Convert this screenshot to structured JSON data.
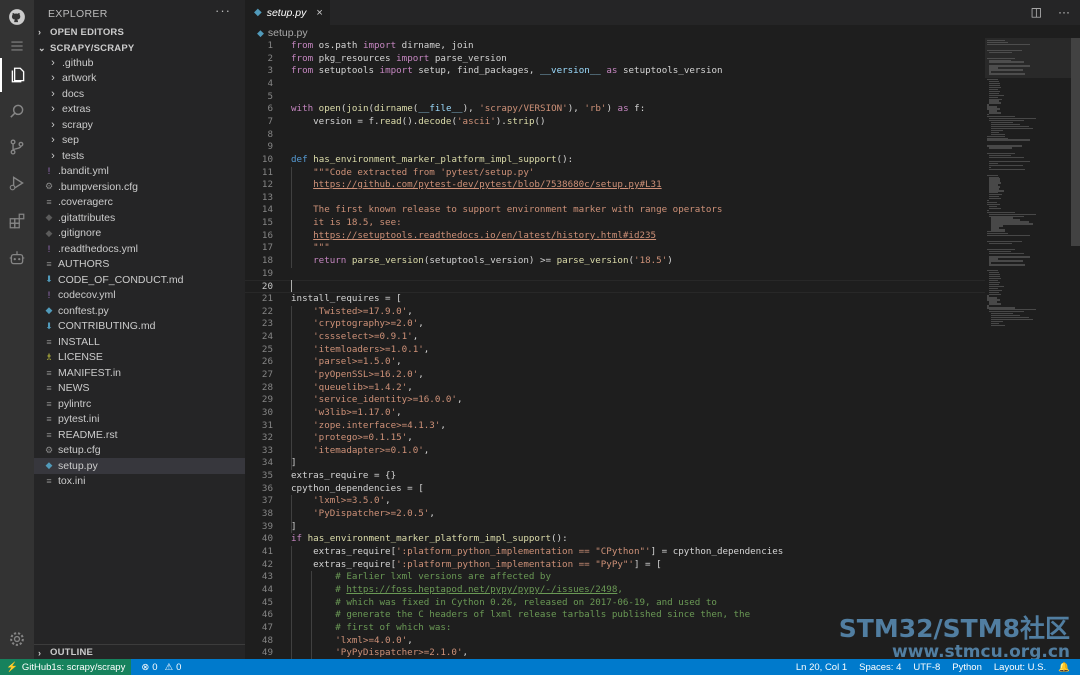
{
  "sidebar": {
    "title": "EXPLORER",
    "more": "···",
    "open_editors": "OPEN EDITORS",
    "folder_name": "SCRAPY/SCRAPY",
    "outline": "OUTLINE",
    "items": [
      {
        "type": "folder",
        "label": ".github"
      },
      {
        "type": "folder",
        "label": "artwork"
      },
      {
        "type": "folder",
        "label": "docs"
      },
      {
        "type": "folder",
        "label": "extras"
      },
      {
        "type": "folder",
        "label": "scrapy"
      },
      {
        "type": "folder",
        "label": "sep"
      },
      {
        "type": "folder",
        "label": "tests"
      },
      {
        "type": "file",
        "label": ".bandit.yml",
        "icon": "!",
        "color": "#a074c4"
      },
      {
        "type": "file",
        "label": ".bumpversion.cfg",
        "icon": "⚙",
        "color": "#8a8a8a"
      },
      {
        "type": "file",
        "label": ".coveragerc",
        "icon": "≡",
        "color": "#8a8a8a"
      },
      {
        "type": "file",
        "label": ".gitattributes",
        "icon": "◆",
        "color": "#5b5b5b"
      },
      {
        "type": "file",
        "label": ".gitignore",
        "icon": "◆",
        "color": "#5b5b5b"
      },
      {
        "type": "file",
        "label": ".readthedocs.yml",
        "icon": "!",
        "color": "#a074c4"
      },
      {
        "type": "file",
        "label": "AUTHORS",
        "icon": "≡",
        "color": "#8a8a8a"
      },
      {
        "type": "file",
        "label": "CODE_OF_CONDUCT.md",
        "icon": "⬇",
        "color": "#519aba"
      },
      {
        "type": "file",
        "label": "codecov.yml",
        "icon": "!",
        "color": "#a074c4"
      },
      {
        "type": "file",
        "label": "conftest.py",
        "icon": "◆",
        "color": "#519aba"
      },
      {
        "type": "file",
        "label": "CONTRIBUTING.md",
        "icon": "⬇",
        "color": "#519aba"
      },
      {
        "type": "file",
        "label": "INSTALL",
        "icon": "≡",
        "color": "#8a8a8a"
      },
      {
        "type": "file",
        "label": "LICENSE",
        "icon": "♗",
        "color": "#cbcb41"
      },
      {
        "type": "file",
        "label": "MANIFEST.in",
        "icon": "≡",
        "color": "#8a8a8a"
      },
      {
        "type": "file",
        "label": "NEWS",
        "icon": "≡",
        "color": "#8a8a8a"
      },
      {
        "type": "file",
        "label": "pylintrc",
        "icon": "≡",
        "color": "#8a8a8a"
      },
      {
        "type": "file",
        "label": "pytest.ini",
        "icon": "≡",
        "color": "#8a8a8a"
      },
      {
        "type": "file",
        "label": "README.rst",
        "icon": "≡",
        "color": "#8a8a8a"
      },
      {
        "type": "file",
        "label": "setup.cfg",
        "icon": "⚙",
        "color": "#8a8a8a"
      },
      {
        "type": "file",
        "label": "setup.py",
        "icon": "◆",
        "color": "#519aba",
        "selected": true
      },
      {
        "type": "file",
        "label": "tox.ini",
        "icon": "≡",
        "color": "#8a8a8a"
      }
    ]
  },
  "tab": {
    "label": "setup.py",
    "close": "×"
  },
  "breadcrumb": {
    "file": "setup.py"
  },
  "editor": {
    "current_line": 20,
    "lines": [
      [
        [
          "from",
          "#c586c0"
        ],
        [
          " os.path ",
          "#d4d4d4"
        ],
        [
          "import",
          "#c586c0"
        ],
        [
          " dirname, join",
          "#d4d4d4"
        ]
      ],
      [
        [
          "from",
          "#c586c0"
        ],
        [
          " pkg_resources ",
          "#d4d4d4"
        ],
        [
          "import",
          "#c586c0"
        ],
        [
          " parse_version",
          "#d4d4d4"
        ]
      ],
      [
        [
          "from",
          "#c586c0"
        ],
        [
          " setuptools ",
          "#d4d4d4"
        ],
        [
          "import",
          "#c586c0"
        ],
        [
          " setup, find_packages, ",
          "#d4d4d4"
        ],
        [
          "__version__",
          "#9cdcfe"
        ],
        [
          " as ",
          "#c586c0"
        ],
        [
          "setuptools_version",
          "#d4d4d4"
        ]
      ],
      [],
      [],
      [
        [
          "with",
          "#c586c0"
        ],
        [
          " open",
          "#dcdcaa"
        ],
        [
          "(",
          "#d4d4d4"
        ],
        [
          "join",
          "#dcdcaa"
        ],
        [
          "(",
          "#d4d4d4"
        ],
        [
          "dirname",
          "#dcdcaa"
        ],
        [
          "(",
          "#d4d4d4"
        ],
        [
          "__file__",
          "#9cdcfe"
        ],
        [
          "), ",
          "#d4d4d4"
        ],
        [
          "'scrapy/VERSION'",
          "#ce9178"
        ],
        [
          "), ",
          "#d4d4d4"
        ],
        [
          "'rb'",
          "#ce9178"
        ],
        [
          ") ",
          "#d4d4d4"
        ],
        [
          "as",
          "#c586c0"
        ],
        [
          " f:",
          "#d4d4d4"
        ]
      ],
      [
        [
          "    version = f.",
          "#d4d4d4"
        ],
        [
          "read",
          "#dcdcaa"
        ],
        [
          "().",
          "#d4d4d4"
        ],
        [
          "decode",
          "#dcdcaa"
        ],
        [
          "(",
          "#d4d4d4"
        ],
        [
          "'ascii'",
          "#ce9178"
        ],
        [
          ").",
          "#d4d4d4"
        ],
        [
          "strip",
          "#dcdcaa"
        ],
        [
          "()",
          "#d4d4d4"
        ]
      ],
      [],
      [],
      [
        [
          "def",
          "#569cd6"
        ],
        [
          " ",
          "#d4d4d4"
        ],
        [
          "has_environment_marker_platform_impl_support",
          "#dcdcaa"
        ],
        [
          "():",
          "#d4d4d4"
        ]
      ],
      [
        [
          "    \"\"\"Code extracted from 'pytest/setup.py'",
          "#ce9178"
        ]
      ],
      [
        [
          "    ",
          "#ce9178"
        ],
        [
          "https://github.com/pytest-dev/pytest/blob/7538680c/setup.py#L31",
          "#ce9178",
          "u"
        ]
      ],
      [],
      [
        [
          "    The first known release to support environment marker with range operators",
          "#ce9178"
        ]
      ],
      [
        [
          "    it is 18.5, see:",
          "#ce9178"
        ]
      ],
      [
        [
          "    ",
          "#ce9178"
        ],
        [
          "https://setuptools.readthedocs.io/en/latest/history.html#id235",
          "#ce9178",
          "u"
        ]
      ],
      [
        [
          "    \"\"\"",
          "#ce9178"
        ]
      ],
      [
        [
          "    ",
          "#d4d4d4"
        ],
        [
          "return",
          "#c586c0"
        ],
        [
          " ",
          "#d4d4d4"
        ],
        [
          "parse_version",
          "#dcdcaa"
        ],
        [
          "(setuptools_version) >= ",
          "#d4d4d4"
        ],
        [
          "parse_version",
          "#dcdcaa"
        ],
        [
          "(",
          "#d4d4d4"
        ],
        [
          "'18.5'",
          "#ce9178"
        ],
        [
          ")",
          "#d4d4d4"
        ]
      ],
      [],
      [],
      [
        [
          "install_requires = [",
          "#d4d4d4"
        ]
      ],
      [
        [
          "    ",
          "#d4d4d4"
        ],
        [
          "'Twisted>=17.9.0'",
          "#ce9178"
        ],
        [
          ",",
          "#d4d4d4"
        ]
      ],
      [
        [
          "    ",
          "#d4d4d4"
        ],
        [
          "'cryptography>=2.0'",
          "#ce9178"
        ],
        [
          ",",
          "#d4d4d4"
        ]
      ],
      [
        [
          "    ",
          "#d4d4d4"
        ],
        [
          "'cssselect>=0.9.1'",
          "#ce9178"
        ],
        [
          ",",
          "#d4d4d4"
        ]
      ],
      [
        [
          "    ",
          "#d4d4d4"
        ],
        [
          "'itemloaders>=1.0.1'",
          "#ce9178"
        ],
        [
          ",",
          "#d4d4d4"
        ]
      ],
      [
        [
          "    ",
          "#d4d4d4"
        ],
        [
          "'parsel>=1.5.0'",
          "#ce9178"
        ],
        [
          ",",
          "#d4d4d4"
        ]
      ],
      [
        [
          "    ",
          "#d4d4d4"
        ],
        [
          "'pyOpenSSL>=16.2.0'",
          "#ce9178"
        ],
        [
          ",",
          "#d4d4d4"
        ]
      ],
      [
        [
          "    ",
          "#d4d4d4"
        ],
        [
          "'queuelib>=1.4.2'",
          "#ce9178"
        ],
        [
          ",",
          "#d4d4d4"
        ]
      ],
      [
        [
          "    ",
          "#d4d4d4"
        ],
        [
          "'service_identity>=16.0.0'",
          "#ce9178"
        ],
        [
          ",",
          "#d4d4d4"
        ]
      ],
      [
        [
          "    ",
          "#d4d4d4"
        ],
        [
          "'w3lib>=1.17.0'",
          "#ce9178"
        ],
        [
          ",",
          "#d4d4d4"
        ]
      ],
      [
        [
          "    ",
          "#d4d4d4"
        ],
        [
          "'zope.interface>=4.1.3'",
          "#ce9178"
        ],
        [
          ",",
          "#d4d4d4"
        ]
      ],
      [
        [
          "    ",
          "#d4d4d4"
        ],
        [
          "'protego>=0.1.15'",
          "#ce9178"
        ],
        [
          ",",
          "#d4d4d4"
        ]
      ],
      [
        [
          "    ",
          "#d4d4d4"
        ],
        [
          "'itemadapter>=0.1.0'",
          "#ce9178"
        ],
        [
          ",",
          "#d4d4d4"
        ]
      ],
      [
        [
          "]",
          "#d4d4d4"
        ]
      ],
      [
        [
          "extras_require = {}",
          "#d4d4d4"
        ]
      ],
      [
        [
          "cpython_dependencies = [",
          "#d4d4d4"
        ]
      ],
      [
        [
          "    ",
          "#d4d4d4"
        ],
        [
          "'lxml>=3.5.0'",
          "#ce9178"
        ],
        [
          ",",
          "#d4d4d4"
        ]
      ],
      [
        [
          "    ",
          "#d4d4d4"
        ],
        [
          "'PyDispatcher>=2.0.5'",
          "#ce9178"
        ],
        [
          ",",
          "#d4d4d4"
        ]
      ],
      [
        [
          "]",
          "#d4d4d4"
        ]
      ],
      [
        [
          "if",
          "#c586c0"
        ],
        [
          " ",
          "#d4d4d4"
        ],
        [
          "has_environment_marker_platform_impl_support",
          "#dcdcaa"
        ],
        [
          "():",
          "#d4d4d4"
        ]
      ],
      [
        [
          "    extras_require[",
          "#d4d4d4"
        ],
        [
          "':platform_python_implementation == \"CPython\"'",
          "#ce9178"
        ],
        [
          "] = cpython_dependencies",
          "#d4d4d4"
        ]
      ],
      [
        [
          "    extras_require[",
          "#d4d4d4"
        ],
        [
          "':platform_python_implementation == \"PyPy\"'",
          "#ce9178"
        ],
        [
          "] = [",
          "#d4d4d4"
        ]
      ],
      [
        [
          "        # Earlier lxml versions are affected by",
          "#6a9955"
        ]
      ],
      [
        [
          "        # ",
          "#6a9955"
        ],
        [
          "https://foss.heptapod.net/pypy/pypy/-/issues/2498",
          "#6a9955",
          "u"
        ],
        [
          ",",
          "#6a9955"
        ]
      ],
      [
        [
          "        # which was fixed in Cython 0.26, released on 2017-06-19, and used to",
          "#6a9955"
        ]
      ],
      [
        [
          "        # generate the C headers of lxml release tarballs published since then, the",
          "#6a9955"
        ]
      ],
      [
        [
          "        # first of which was:",
          "#6a9955"
        ]
      ],
      [
        [
          "        ",
          "#d4d4d4"
        ],
        [
          "'lxml>=4.0.0'",
          "#ce9178"
        ],
        [
          ",",
          "#d4d4d4"
        ]
      ],
      [
        [
          "        ",
          "#d4d4d4"
        ],
        [
          "'PyPyDispatcher>=2.1.0'",
          "#ce9178"
        ],
        [
          ",",
          "#d4d4d4"
        ]
      ]
    ]
  },
  "status": {
    "remote": "GitHub1s: scrapy/scrapy",
    "errors": "0",
    "warnings": "0",
    "position": "Ln 20, Col 1",
    "spaces": "Spaces: 4",
    "encoding": "UTF-8",
    "language": "Python",
    "layout": "Layout: U.S."
  },
  "watermark": {
    "line1": "STM32/STM8社区",
    "line2": "www.stmcu.org.cn"
  },
  "icons": [
    "github-icon",
    "menu-icon",
    "files-icon",
    "search-icon",
    "source-control-icon",
    "run-debug-icon",
    "extensions-icon",
    "remote-explorer-icon",
    "settings-gear-icon"
  ]
}
